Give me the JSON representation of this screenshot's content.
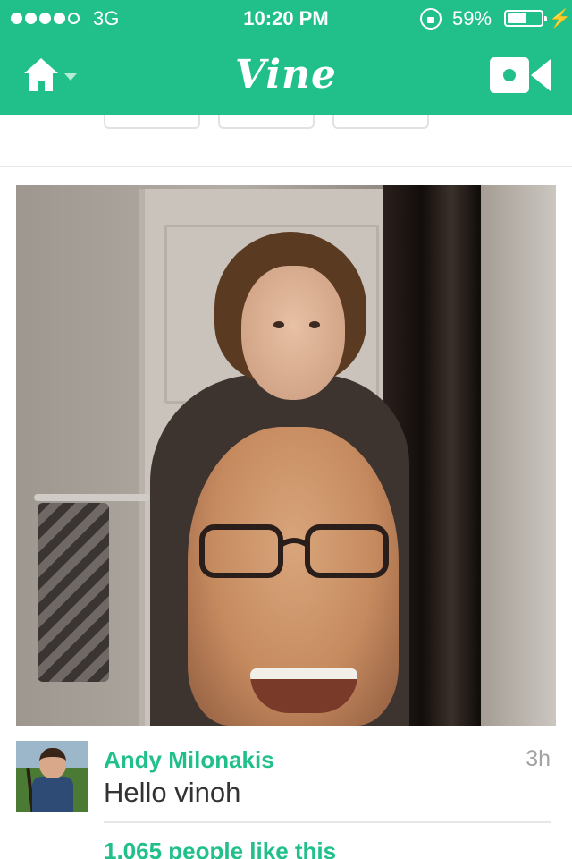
{
  "status_bar": {
    "carrier": "3G",
    "time": "10:20 PM",
    "battery_percent": "59%",
    "battery_level": 0.59,
    "signal_bars_filled": 4,
    "signal_bars_total": 5
  },
  "nav": {
    "logo": "Vine",
    "home_icon": "home-icon",
    "camera_icon": "video-camera-icon"
  },
  "previous_post": {
    "buttons": [
      "like-smile-icon",
      "comment-icon",
      "revine-icon"
    ]
  },
  "post": {
    "username": "Andy Milonakis",
    "time_ago": "3h",
    "caption": "Hello vinoh",
    "likes": "1,065 people like this"
  },
  "colors": {
    "brand": "#21c08b",
    "text": "#333333",
    "muted": "#a3a3a3",
    "divider": "#e6e6e6"
  }
}
